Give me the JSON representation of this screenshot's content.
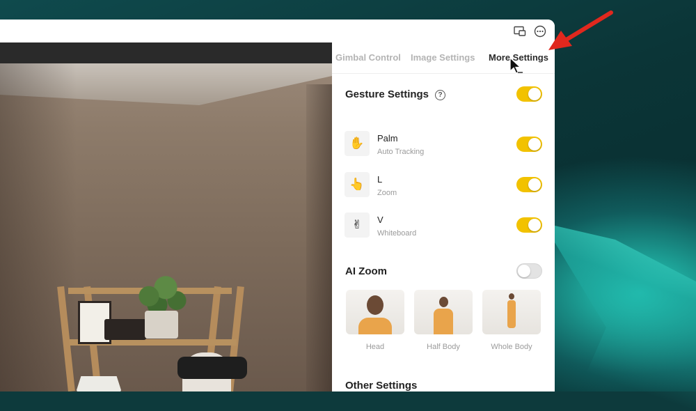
{
  "titlebar": {
    "icons": [
      "picture-in-picture-icon",
      "more-options-icon"
    ]
  },
  "panel": {
    "tabs": [
      {
        "label": "Gimbal Control",
        "active": false
      },
      {
        "label": "Image Settings",
        "active": false
      },
      {
        "label": "More Settings",
        "active": true
      }
    ],
    "gesture_settings": {
      "title": "Gesture Settings",
      "help_icon": "?",
      "enabled": true,
      "items": [
        {
          "name": "Palm",
          "description": "Auto Tracking",
          "icon": "✋",
          "icon_name": "palm-gesture-icon",
          "enabled": true
        },
        {
          "name": "L",
          "description": "Zoom",
          "icon": "👆",
          "icon_name": "l-gesture-icon",
          "enabled": true
        },
        {
          "name": "V",
          "description": "Whiteboard",
          "icon": "✌",
          "icon_name": "v-gesture-icon",
          "enabled": true
        }
      ]
    },
    "ai_zoom": {
      "title": "AI Zoom",
      "enabled": false,
      "modes": [
        {
          "label": "Head"
        },
        {
          "label": "Half Body"
        },
        {
          "label": "Whole Body"
        }
      ]
    },
    "other_settings": {
      "title": "Other Settings"
    }
  },
  "colors": {
    "toggle_on": "#f2c200",
    "toggle_off": "#e3e3e3",
    "annotation_arrow": "#e0281e"
  }
}
